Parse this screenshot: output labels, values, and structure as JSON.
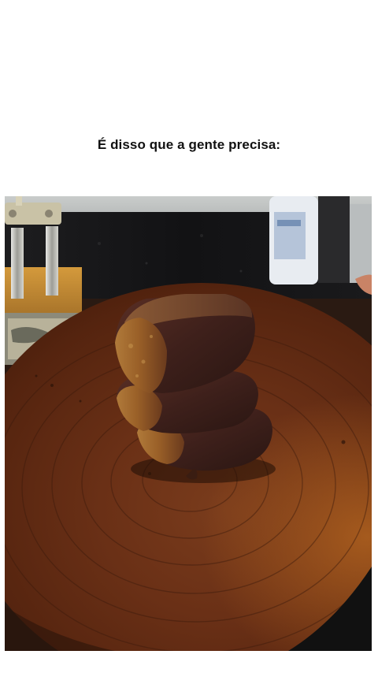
{
  "post": {
    "caption": "É disso que a gente precisa:"
  },
  "photo": {
    "subject": "stacked-grilled-steaks-on-wooden-board"
  }
}
